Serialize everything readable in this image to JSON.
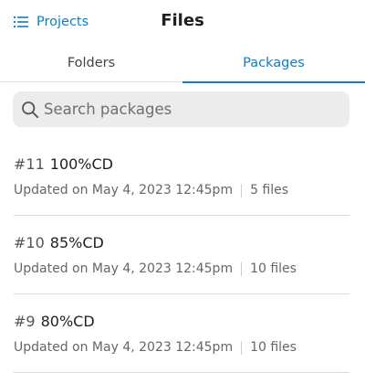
{
  "header": {
    "back_label": "Projects",
    "back_icon": "list-icon",
    "title": "Files"
  },
  "tabs": [
    {
      "label": "Folders",
      "active": false
    },
    {
      "label": "Packages",
      "active": true
    }
  ],
  "search": {
    "placeholder": "Search packages",
    "value": "",
    "icon": "search-icon"
  },
  "packages": [
    {
      "number": "#11",
      "name": "100%CD",
      "updated": "Updated on May 4, 2023 12:45pm",
      "files": "5 files"
    },
    {
      "number": "#10",
      "name": "85%CD",
      "updated": "Updated on May 4, 2023 12:45pm",
      "files": "10 files"
    },
    {
      "number": "#9",
      "name": "80%CD",
      "updated": "Updated on May 4, 2023 12:45pm",
      "files": "10 files"
    }
  ],
  "colors": {
    "accent": "#0b7fc7",
    "search_bg": "#ececec",
    "divider": "#dcdcdc"
  }
}
